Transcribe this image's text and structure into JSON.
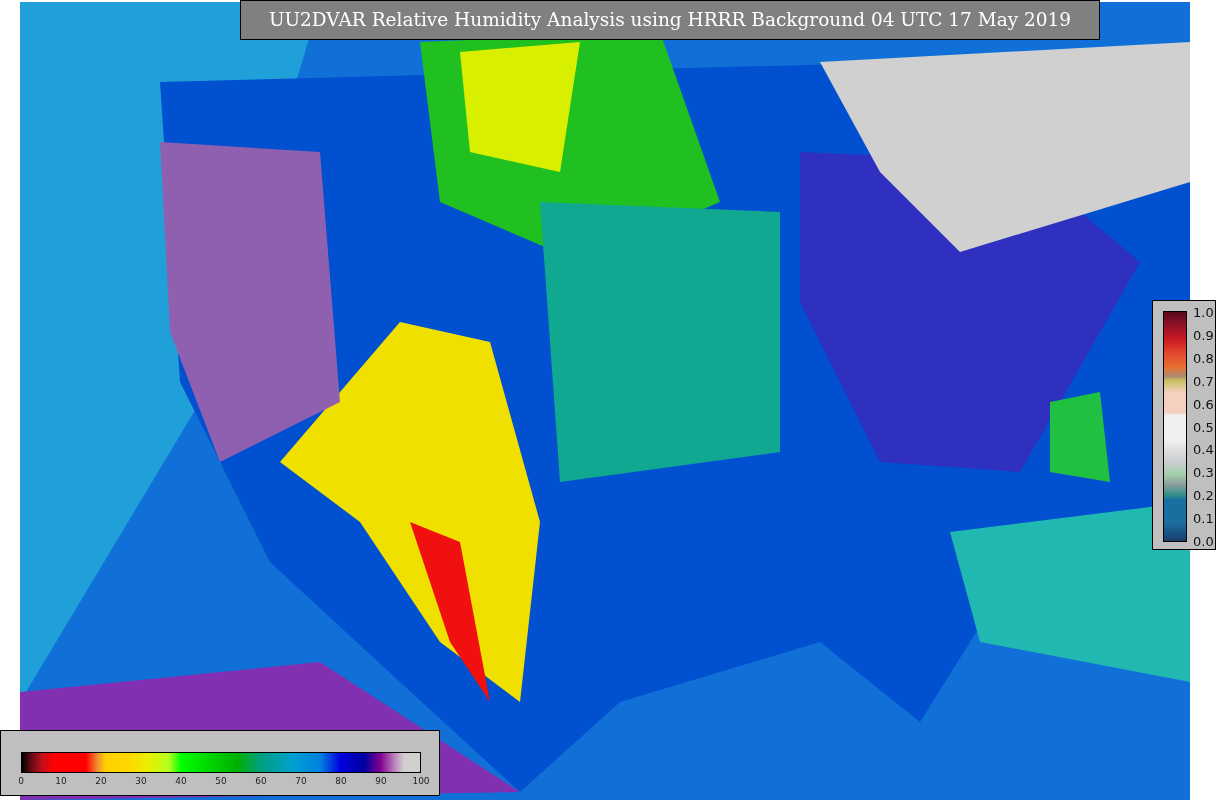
{
  "title": "UU2DVAR Relative Humidity Analysis using HRRR Background 04 UTC 17 May 2019",
  "main_colorbar": {
    "ticks": [
      "0",
      "10",
      "20",
      "30",
      "40",
      "50",
      "60",
      "70",
      "80",
      "90",
      "100"
    ]
  },
  "obs_colorbar": {
    "ticks": [
      "1.0",
      "0.9",
      "0.8",
      "0.7",
      "0.6",
      "0.5",
      "0.4",
      "0.3",
      "0.2",
      "0.1",
      "0.0"
    ]
  }
}
